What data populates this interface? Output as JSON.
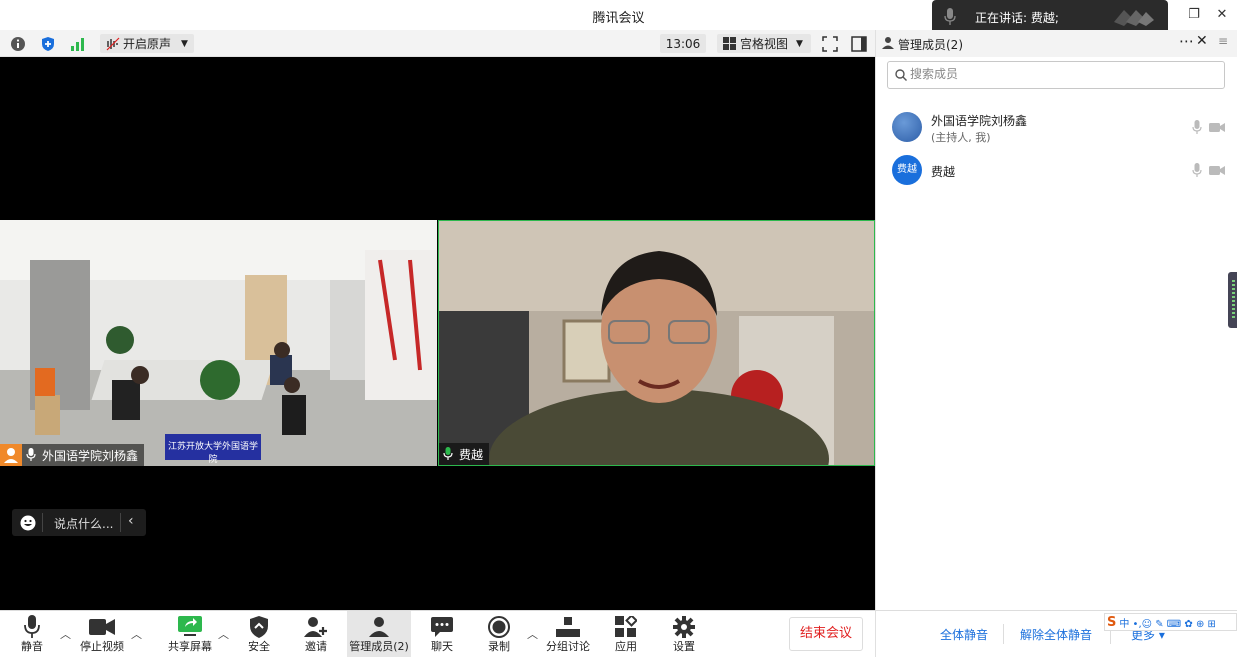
{
  "window": {
    "title": "腾讯会议"
  },
  "toast": {
    "text": "正在讲话: 费越;"
  },
  "toolbar": {
    "original_sound": "开启原声",
    "time": "13:06",
    "view_mode": "宫格视图"
  },
  "panel": {
    "title": "管理成员(2)",
    "search_placeholder": "搜索成员",
    "members": [
      {
        "name": "外国语学院刘杨鑫",
        "role": "(主持人, 我)",
        "avatar_text": ""
      },
      {
        "name": "费越",
        "role": "",
        "avatar_text": "费越"
      }
    ]
  },
  "videos": [
    {
      "name": "外国语学院刘杨鑫",
      "banner": "江苏开放大学外国语学院"
    },
    {
      "name": "费越"
    }
  ],
  "chat": {
    "placeholder": "说点什么..."
  },
  "bottom": {
    "mute": "静音",
    "stop_video": "停止视频",
    "share_screen": "共享屏幕",
    "security": "安全",
    "invite": "邀请",
    "manage_members": "管理成员(2)",
    "chat": "聊天",
    "record": "录制",
    "breakout": "分组讨论",
    "apps": "应用",
    "settings": "设置",
    "end_meeting": "结束会议",
    "mute_all": "全体静音",
    "unmute_all": "解除全体静音",
    "more": "更多"
  },
  "colors": {
    "accent": "#1a6fdc",
    "end": "#e02020",
    "active_green": "#2db84d"
  }
}
